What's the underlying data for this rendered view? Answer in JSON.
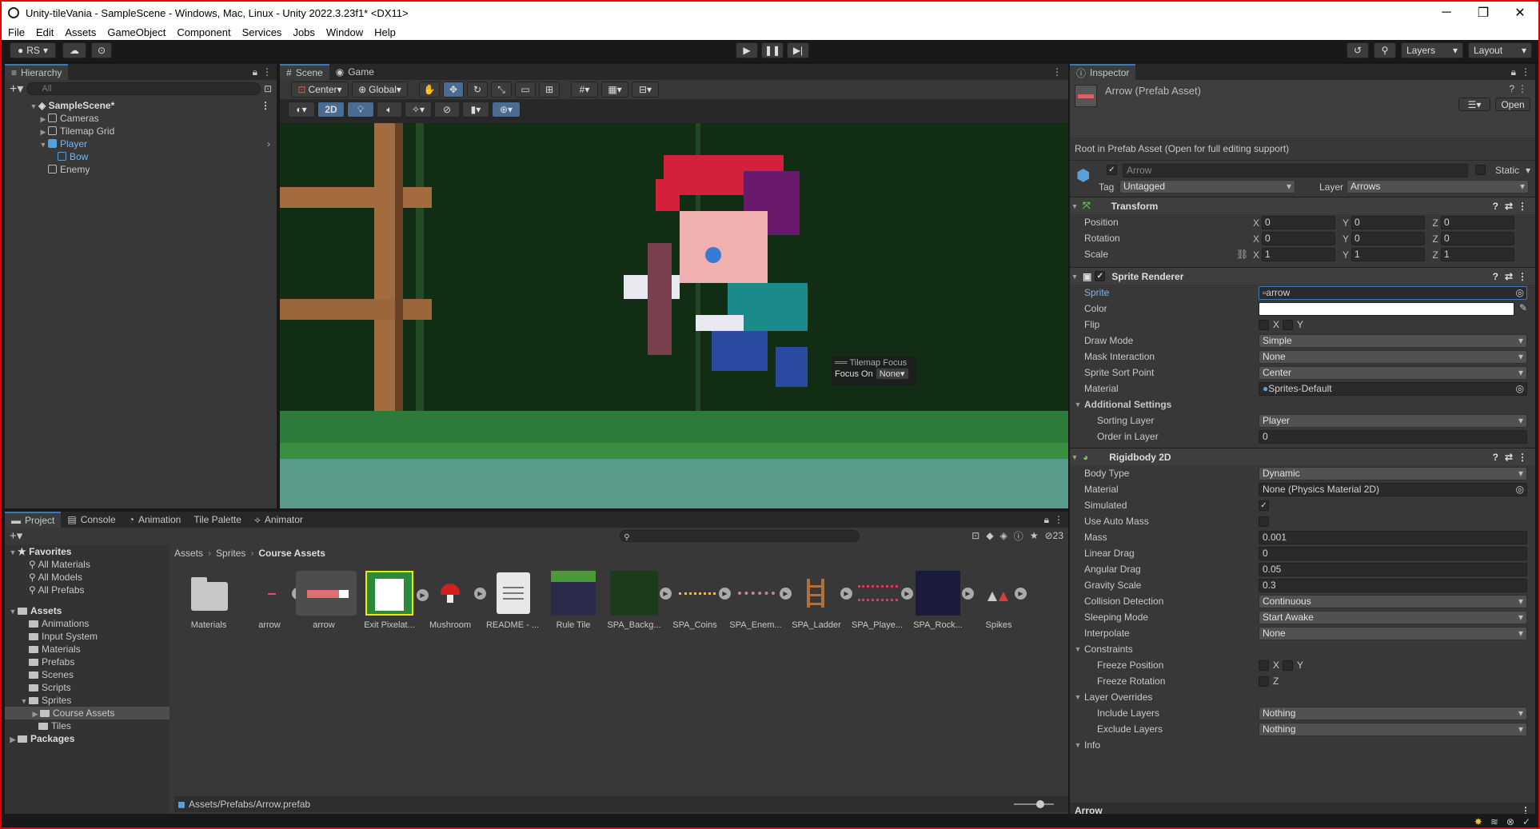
{
  "window": {
    "title": "Unity-tileVania - SampleScene - Windows, Mac, Linux - Unity 2022.3.23f1* <DX11>"
  },
  "menu": [
    "File",
    "Edit",
    "Assets",
    "GameObject",
    "Component",
    "Services",
    "Jobs",
    "Window",
    "Help"
  ],
  "toolbar": {
    "account": "RS",
    "layers": "Layers",
    "layout": "Layout"
  },
  "hierarchy": {
    "tab": "Hierarchy",
    "search_placeholder": "All",
    "scene": "SampleScene*",
    "items": [
      "Cameras",
      "Tilemap Grid",
      "Player",
      "Bow",
      "Enemy"
    ]
  },
  "scene_view": {
    "tabs": [
      "Scene",
      "Game"
    ],
    "pivot": "Center",
    "space": "Global",
    "mode_2d": "2D",
    "overlay_title": "Tilemap Focus",
    "focus_label": "Focus On",
    "focus_value": "None"
  },
  "project": {
    "tabs": [
      "Project",
      "Console",
      "Animation",
      "Tile Palette",
      "Animator"
    ],
    "hidden_count": "23",
    "favorites_label": "Favorites",
    "favorites": [
      "All Materials",
      "All Models",
      "All Prefabs"
    ],
    "assets_label": "Assets",
    "folders": [
      "Animations",
      "Input System",
      "Materials",
      "Prefabs",
      "Scenes",
      "Scripts",
      "Sprites",
      "Course Assets",
      "Tiles"
    ],
    "packages_label": "Packages",
    "breadcrumb": [
      "Assets",
      "Sprites",
      "Course Assets"
    ],
    "assets": [
      "Materials",
      "arrow",
      "arrow",
      "Exit Pixelat...",
      "Mushroom",
      "README - ...",
      "Rule Tile",
      "SPA_Backg...",
      "SPA_Coins",
      "SPA_Enem...",
      "SPA_Ladder",
      "SPA_Playe...",
      "SPA_Rock...",
      "Spikes"
    ],
    "status_path": "Assets/Prefabs/Arrow.prefab"
  },
  "inspector": {
    "tab": "Inspector",
    "asset_title": "Arrow (Prefab Asset)",
    "open_label": "Open",
    "root_note": "Root in Prefab Asset (Open for full editing support)",
    "object_name": "Arrow",
    "static_label": "Static",
    "tag_label": "Tag",
    "tag_value": "Untagged",
    "layer_label": "Layer",
    "layer_value": "Arrows",
    "transform": {
      "title": "Transform",
      "position_label": "Position",
      "position": [
        "0",
        "0",
        "0"
      ],
      "rotation_label": "Rotation",
      "rotation": [
        "0",
        "0",
        "0"
      ],
      "scale_label": "Scale",
      "scale": [
        "1",
        "1",
        "1"
      ]
    },
    "sprite_renderer": {
      "title": "Sprite Renderer",
      "sprite_label": "Sprite",
      "sprite_value": "arrow",
      "color_label": "Color",
      "flip_label": "Flip",
      "draw_mode_label": "Draw Mode",
      "draw_mode": "Simple",
      "mask_label": "Mask Interaction",
      "mask": "None",
      "sort_point_label": "Sprite Sort Point",
      "sort_point": "Center",
      "material_label": "Material",
      "material": "Sprites-Default",
      "additional_label": "Additional Settings",
      "sorting_layer_label": "Sorting Layer",
      "sorting_layer": "Player",
      "order_label": "Order in Layer",
      "order": "0"
    },
    "rigidbody": {
      "title": "Rigidbody 2D",
      "body_type_label": "Body Type",
      "body_type": "Dynamic",
      "material_label": "Material",
      "material": "None (Physics Material 2D)",
      "simulated_label": "Simulated",
      "auto_mass_label": "Use Auto Mass",
      "mass_label": "Mass",
      "mass": "0.001",
      "linear_drag_label": "Linear Drag",
      "linear_drag": "0",
      "angular_drag_label": "Angular Drag",
      "angular_drag": "0.05",
      "gravity_label": "Gravity Scale",
      "gravity": "0.3",
      "collision_label": "Collision Detection",
      "collision": "Continuous",
      "sleep_label": "Sleeping Mode",
      "sleep": "Start Awake",
      "interpolate_label": "Interpolate",
      "interpolate": "None",
      "constraints_label": "Constraints",
      "freeze_pos_label": "Freeze Position",
      "freeze_rot_label": "Freeze Rotation",
      "overrides_label": "Layer Overrides",
      "include_label": "Include Layers",
      "include": "Nothing",
      "exclude_label": "Exclude Layers",
      "exclude": "Nothing",
      "info_label": "Info"
    },
    "footer_name": "Arrow"
  },
  "axis": {
    "x": "X",
    "y": "Y",
    "z": "Z"
  }
}
